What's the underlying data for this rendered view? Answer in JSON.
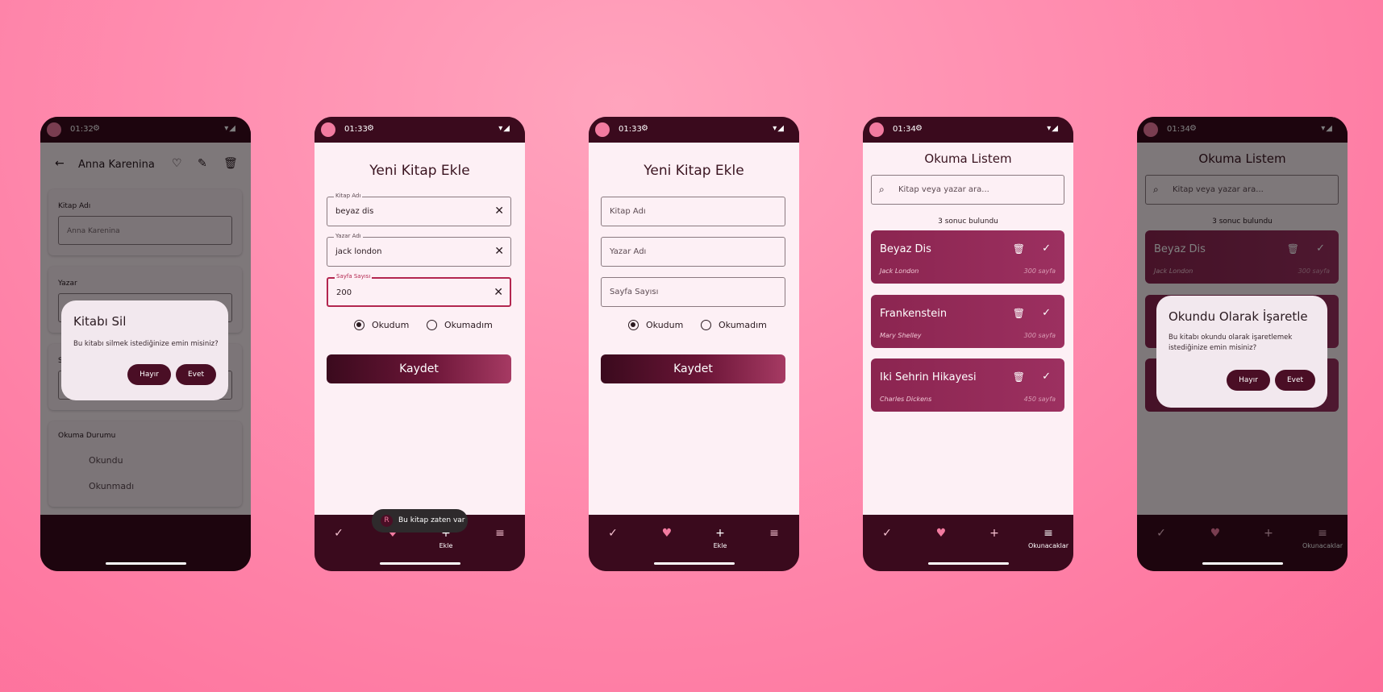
{
  "phones": [
    {
      "status_time": "01:32",
      "topbar": {
        "title": "Anna Karenina"
      },
      "fields": [
        {
          "label": "Kitap Adı",
          "value": "Anna Karenina"
        },
        {
          "label": "Yazar",
          "value": ""
        },
        {
          "label": "S",
          "value": ""
        }
      ],
      "status_section": {
        "label": "Okuma Durumu",
        "options": [
          "Okundu",
          "Okunmadı"
        ]
      },
      "dialog": {
        "title": "Kitabı Sil",
        "text": "Bu kitabı silmek istediğinize emin misiniz?",
        "cancel": "Hayır",
        "confirm": "Evet"
      }
    },
    {
      "status_time": "01:33",
      "title": "Yeni Kitap Ekle",
      "fields": [
        {
          "label": "Kitap Adı",
          "value": "beyaz dis"
        },
        {
          "label": "Yazar Adı",
          "value": "jack london"
        },
        {
          "label": "Sayfa Sayısı",
          "value": "200"
        }
      ],
      "radio": [
        "Okudum",
        "Okumadım"
      ],
      "save_label": "Kaydet",
      "toast": {
        "icon": "R",
        "text": "Bu kitap zaten var"
      },
      "nav": [
        "",
        "",
        "Ekle",
        ""
      ]
    },
    {
      "status_time": "01:33",
      "title": "Yeni Kitap Ekle",
      "placeholders": [
        "Kitap Adı",
        "Yazar Adı",
        "Sayfa Sayısı"
      ],
      "radio": [
        "Okudum",
        "Okumadım"
      ],
      "save_label": "Kaydet",
      "nav": [
        "",
        "",
        "Ekle",
        ""
      ]
    },
    {
      "status_time": "01:34",
      "title": "Okuma Listem",
      "search_placeholder": "Kitap veya yazar ara...",
      "result_count": "3 sonuc bulundu",
      "books": [
        {
          "title": "Beyaz Dis",
          "author": "Jack London",
          "pages": "300 sayfa"
        },
        {
          "title": "Frankenstein",
          "author": "Mary Shelley",
          "pages": "300 sayfa"
        },
        {
          "title": "Iki Sehrin Hikayesi",
          "author": "Charles Dickens",
          "pages": "450 sayfa"
        }
      ],
      "nav": [
        "",
        "",
        "",
        "Okunacaklar"
      ]
    },
    {
      "status_time": "01:34",
      "title": "Okuma Listem",
      "search_placeholder": "Kitap veya yazar ara...",
      "result_count": "3 sonuc bulundu",
      "books": [
        {
          "title": "Beyaz Dis",
          "author": "Jack London",
          "pages": "300 sayfa"
        }
      ],
      "dialog": {
        "title": "Okundu Olarak İşaretle",
        "text": "Bu kitabı okundu olarak işaretlemek istediğinize emin misiniz?",
        "cancel": "Hayır",
        "confirm": "Evet"
      },
      "nav": [
        "",
        "",
        "",
        "Okunacaklar"
      ]
    }
  ],
  "icons": {
    "back": "arrow-left-icon",
    "favorite": "heart-outline-icon",
    "edit": "pencil-icon",
    "delete": "trash-icon",
    "check": "check-icon",
    "heart": "heart-icon",
    "add": "plus-icon",
    "menu": "menu-icon",
    "search": "search-icon",
    "clear": "close-icon"
  },
  "colors": {
    "background_center": "#ffa4bd",
    "background_edge": "#fd6f9a",
    "phone_frame": "#3a0a1d",
    "screen_bg": "#fdf0f5",
    "card": "#8b2550",
    "accent": "#b3264f",
    "dialog_bg": "#f2e8ee",
    "dialog_button": "#4a0e25"
  }
}
